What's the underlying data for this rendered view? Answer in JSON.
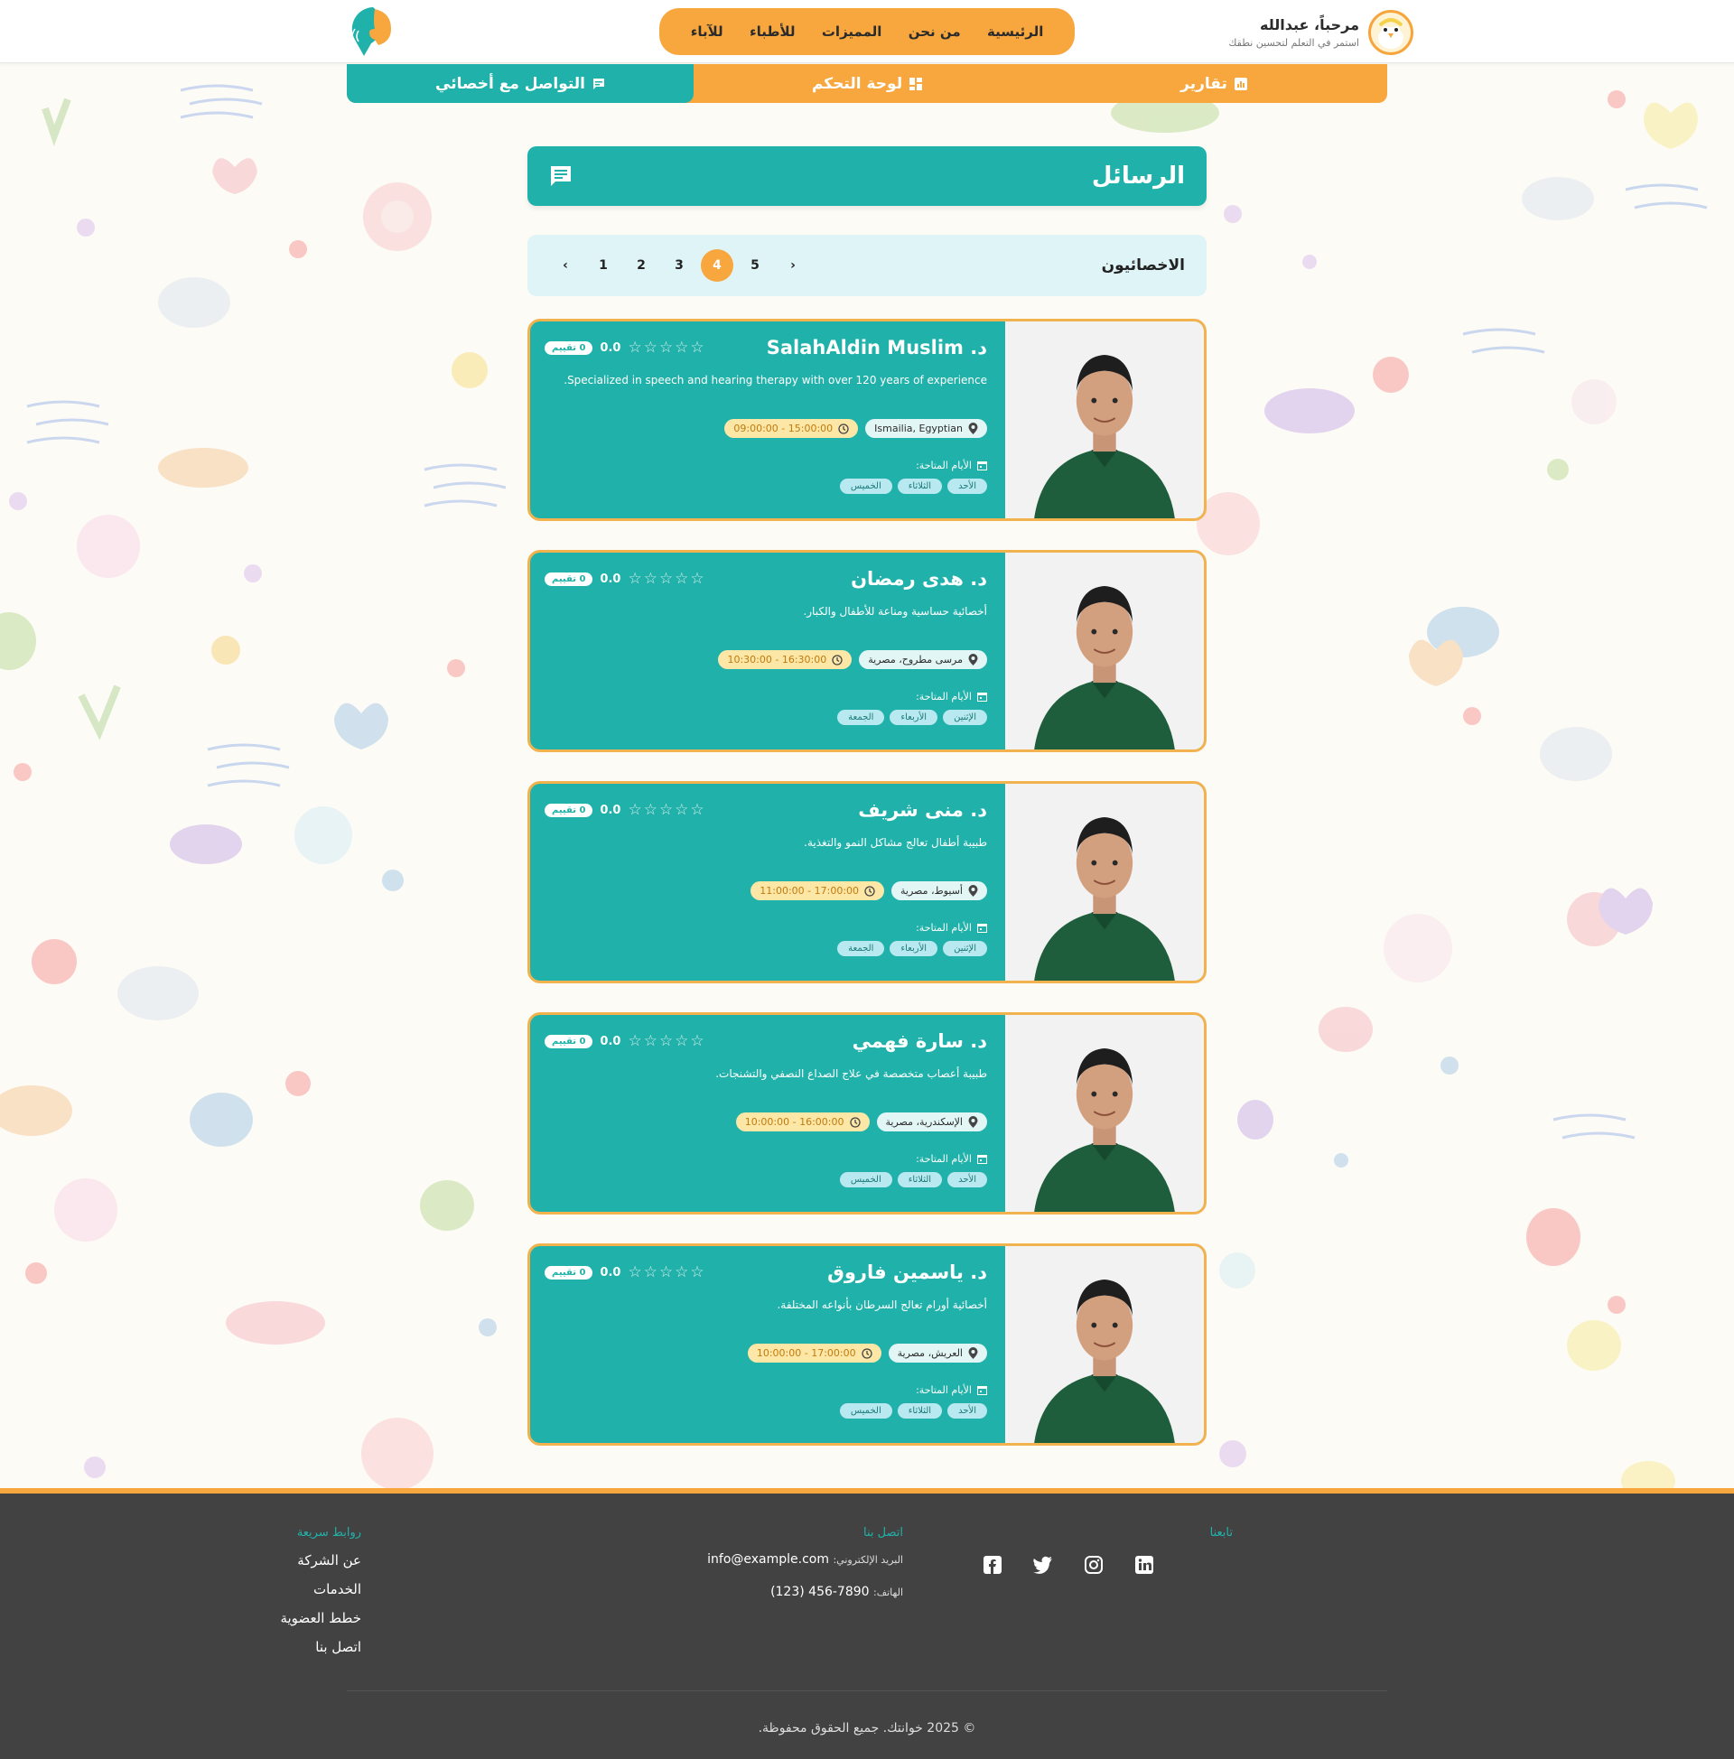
{
  "header": {
    "greeting": "مرحباً، عبدالله",
    "subtitle": "استمر في التعلم لتحسين نطقك",
    "nav": [
      "الرئيسية",
      "من نحن",
      "المميزات",
      "للأطباء",
      "للآباء"
    ]
  },
  "tabs": [
    {
      "label": "تقارير",
      "icon": "chart-icon"
    },
    {
      "label": "لوحة التحكم",
      "icon": "dashboard-icon"
    },
    {
      "label": "التواصل مع أخصائي",
      "icon": "chat-icon"
    }
  ],
  "active_tab": "التواصل مع أخصائي",
  "messages": {
    "title": "الرسائل",
    "icon": "message-icon"
  },
  "pager": {
    "title": "الاخصائيون",
    "pages": [
      "1",
      "2",
      "3",
      "4",
      "5"
    ],
    "active_page": "4",
    "prev_symbol": "‹",
    "next_symbol": "›"
  },
  "rating_stars": "☆☆☆☆☆",
  "days_label": "الأيام المتاحة:",
  "doctors": [
    {
      "name": "د. SalahAldin Muslim",
      "rating": "0.0",
      "reviews": "0 تقييم",
      "desc": "Specialized in speech and hearing therapy with over 120 years of experience.",
      "location": "Ismailia, Egyptian",
      "time": "09:00:00 - 15:00:00",
      "days": [
        "الأحد",
        "الثلاثاء",
        "الخميس"
      ]
    },
    {
      "name": "د. هدى رمضان",
      "rating": "0.0",
      "reviews": "0 تقييم",
      "desc": "أخصائية حساسية ومناعة للأطفال والكبار.",
      "location": "مرسى مطروح، مصرية",
      "time": "10:30:00 - 16:30:00",
      "days": [
        "الإثنين",
        "الأربعاء",
        "الجمعة"
      ]
    },
    {
      "name": "د. منى شريف",
      "rating": "0.0",
      "reviews": "0 تقييم",
      "desc": "طبيبة أطفال تعالج مشاكل النمو والتغذية.",
      "location": "أسيوط، مصرية",
      "time": "11:00:00 - 17:00:00",
      "days": [
        "الإثنين",
        "الأربعاء",
        "الجمعة"
      ]
    },
    {
      "name": "د. سارة فهمي",
      "rating": "0.0",
      "reviews": "0 تقييم",
      "desc": "طبيبة أعصاب متخصصة في علاج الصداع النصفي والتشنجات.",
      "location": "الإسكندرية، مصرية",
      "time": "10:00:00 - 16:00:00",
      "days": [
        "الأحد",
        "الثلاثاء",
        "الخميس"
      ]
    },
    {
      "name": "د. ياسمين فاروق",
      "rating": "0.0",
      "reviews": "0 تقييم",
      "desc": "أخصائية أورام تعالج السرطان بأنواعه المختلفة.",
      "location": "العريش، مصرية",
      "time": "10:00:00 - 17:00:00",
      "days": [
        "الأحد",
        "الثلاثاء",
        "الخميس"
      ]
    }
  ],
  "footer": {
    "quick_links_title": "روابط سريعة",
    "quick_links": [
      "عن الشركة",
      "الخدمات",
      "خطط العضوية",
      "اتصل بنا"
    ],
    "contact_title": "اتصل بنا",
    "email_label": "البريد الإلكتروني:",
    "email": "info@example.com",
    "phone_label": "الهاتف:",
    "phone": "(123) 456-7890",
    "follow_title": "تابعنا",
    "socials": [
      "facebook-icon",
      "twitter-icon",
      "instagram-icon",
      "linkedin-icon"
    ],
    "copyright": "© 2025 خوانتك. جميع الحقوق محفوظة."
  },
  "colors": {
    "teal": "#20b2aa",
    "orange": "#f8a73e",
    "footer_bg": "#424242"
  }
}
